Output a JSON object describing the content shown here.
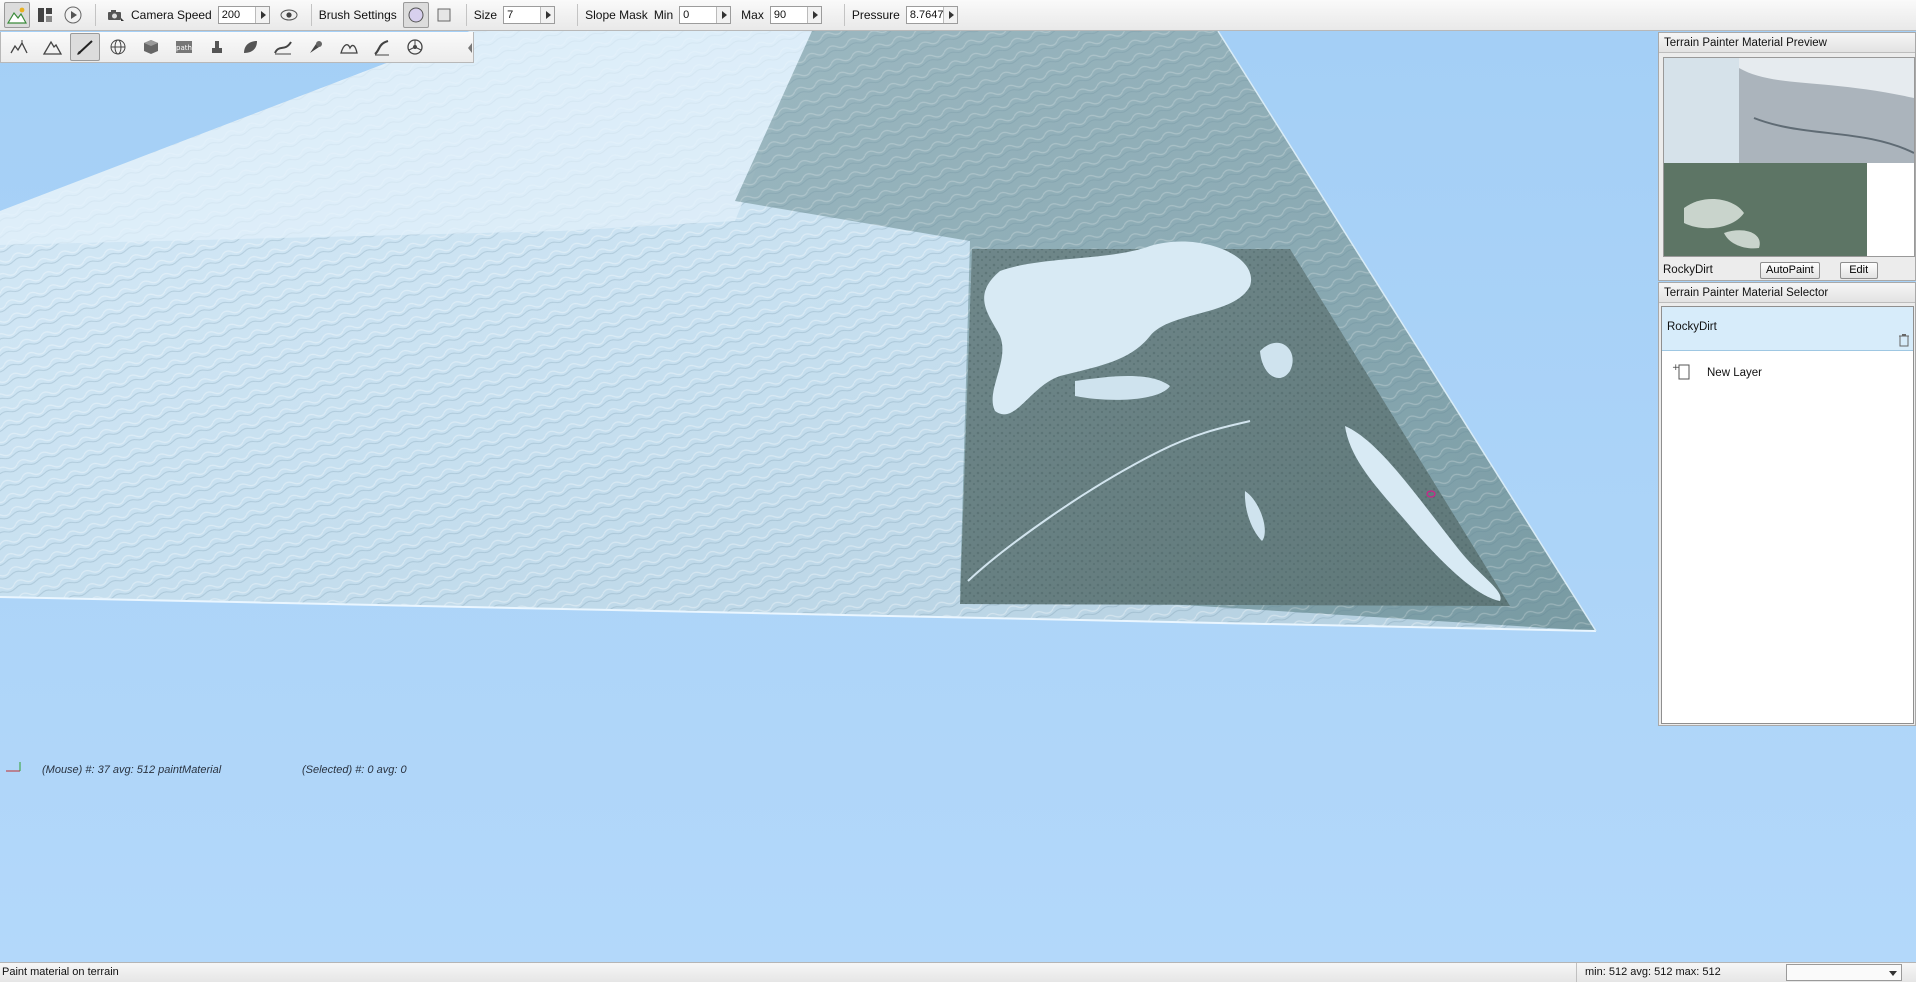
{
  "toolbar": {
    "camera_speed_label": "Camera Speed",
    "camera_speed_value": "200",
    "brush_settings_label": "Brush Settings",
    "size_label": "Size",
    "size_value": "7",
    "slope_mask_label": "Slope Mask",
    "min_label": "Min",
    "min_value": "0",
    "max_label": "Max",
    "max_value": "90",
    "pressure_label": "Pressure",
    "pressure_value": "8.7647"
  },
  "subtoolbar": {
    "tools": [
      "elevate-icon",
      "mountain-icon",
      "brush-pencil-icon",
      "globe-icon",
      "cube-icon",
      "path-icon",
      "stamp-icon",
      "leaf-icon",
      "river-icon",
      "pin-icon",
      "hills-icon",
      "road-icon",
      "steering-icon"
    ],
    "active_index": 2,
    "path_text": "path"
  },
  "preview": {
    "title": "Terrain Painter Material Preview",
    "material_name": "RockyDirt",
    "autopaint_label": "AutoPaint",
    "edit_label": "Edit"
  },
  "selector": {
    "title": "Terrain Painter Material Selector",
    "layers": [
      {
        "label": "RockyDirt",
        "selected": true
      },
      {
        "label": "New Layer",
        "selected": false
      }
    ]
  },
  "hud": {
    "mouse_info": "(Mouse) #: 37  avg: 512 paintMaterial",
    "selected_info": "(Selected) #: 0  avg: 0"
  },
  "status": {
    "message": "Paint material on terrain",
    "stats": "min: 512  avg: 512  max: 512",
    "dropdown_value": ""
  },
  "colors": {
    "sky": "#aad4f8",
    "selection": "#d7ecfa",
    "toolbar_bg": "#ececec"
  }
}
